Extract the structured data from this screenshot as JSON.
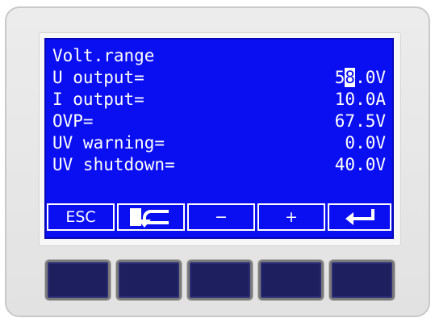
{
  "display": {
    "rows": [
      {
        "label": "Volt.range",
        "value": ""
      },
      {
        "label": "U output=",
        "value_pre": "5",
        "value_cursor": "8",
        "value_post": ".0V"
      },
      {
        "label": "I output=",
        "value": "10.0A"
      },
      {
        "label": "OVP=",
        "value": "67.5V"
      },
      {
        "label": "UV warning=",
        "value": "0.0V"
      },
      {
        "label": "UV shutdown=",
        "value": "40.0V"
      }
    ]
  },
  "softkeys": {
    "esc_label": "ESC",
    "cursor_icon": "cursor-return-icon",
    "minus_label": "−",
    "plus_label": "+",
    "enter_icon": "enter-arrow-icon"
  },
  "colors": {
    "lcd_background": "#0a0ff2",
    "lcd_text": "#ffffff",
    "hardware_key": "#1e1f5e"
  }
}
